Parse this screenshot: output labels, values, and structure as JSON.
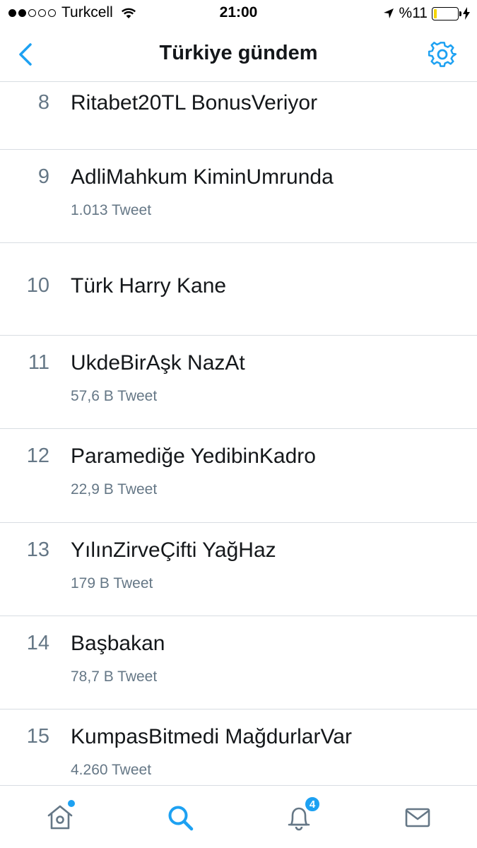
{
  "status_bar": {
    "carrier": "Turkcell",
    "time": "21:00",
    "battery_text": "%11",
    "battery_level": 0.11,
    "battery_color": "#f5d500"
  },
  "header": {
    "title": "Türkiye gündem",
    "back_icon": "chevron-left-icon",
    "settings_icon": "gear-icon"
  },
  "trends": [
    {
      "rank": "8",
      "name": "Ritabet20TL BonusVeriyor",
      "tweets": ""
    },
    {
      "rank": "9",
      "name": "AdliMahkum KiminUmrunda",
      "tweets": "1.013 Tweet"
    },
    {
      "rank": "10",
      "name": "Türk Harry Kane",
      "tweets": ""
    },
    {
      "rank": "11",
      "name": "UkdeBirAşk NazAt",
      "tweets": "57,6 B Tweet"
    },
    {
      "rank": "12",
      "name": "Paramediğe YedibinKadro",
      "tweets": "22,9 B Tweet"
    },
    {
      "rank": "13",
      "name": "YılınZirveÇifti YağHaz",
      "tweets": "179 B Tweet"
    },
    {
      "rank": "14",
      "name": "Başbakan",
      "tweets": "78,7 B Tweet"
    },
    {
      "rank": "15",
      "name": "KumpasBitmedi MağdurlarVar",
      "tweets": "4.260 Tweet"
    }
  ],
  "tab_bar": {
    "notifications_badge": "4",
    "icons": [
      "home-icon",
      "search-icon",
      "bell-icon",
      "mail-icon"
    ]
  },
  "colors": {
    "accent": "#1da1f2",
    "primary_text": "#14171a",
    "secondary_text": "#657786",
    "divider": "#d8dde2"
  }
}
